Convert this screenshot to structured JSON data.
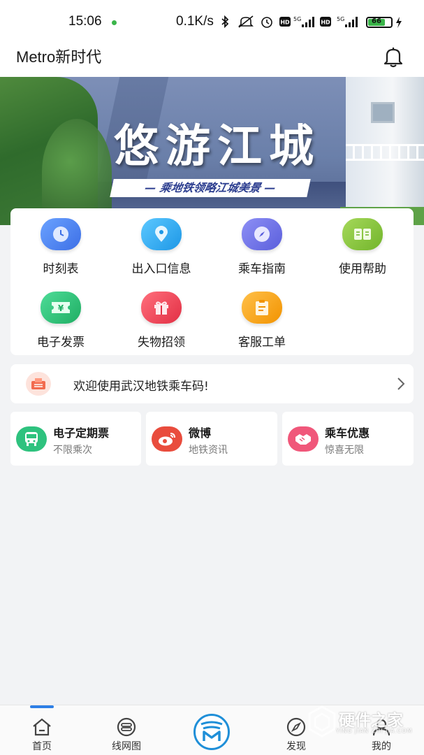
{
  "status_bar": {
    "time": "15:06",
    "network_speed": "0.1K/s",
    "battery": "66",
    "hd_label": "HD",
    "signal_label": "5G"
  },
  "header": {
    "title": "Metro新时代",
    "bell_icon": "bell-icon"
  },
  "banner": {
    "title": "悠游江城",
    "subtitle": "— 乘地铁领略江城美景 —"
  },
  "quick_grid": {
    "items": [
      {
        "label": "时刻表",
        "icon": "clock-icon",
        "color": "#4a84f0"
      },
      {
        "label": "出入口信息",
        "icon": "location-pin-icon",
        "color": "#2fa8ef"
      },
      {
        "label": "乘车指南",
        "icon": "compass-icon",
        "color": "#6f74e8"
      },
      {
        "label": "使用帮助",
        "icon": "book-icon",
        "color": "#8cc63f"
      },
      {
        "label": "电子发票",
        "icon": "ticket-yen-icon",
        "color": "#2fc27d"
      },
      {
        "label": "失物招领",
        "icon": "gift-icon",
        "color": "#ef4b5b"
      },
      {
        "label": "客服工单",
        "icon": "clipboard-icon",
        "color": "#f7a11a"
      }
    ]
  },
  "notice": {
    "text": "欢迎使用武汉地铁乘车码!",
    "icon": "mailbox-icon"
  },
  "features": [
    {
      "title": "电子定期票",
      "subtitle": "不限乘次",
      "icon": "bus-icon",
      "color": "#2ec27e"
    },
    {
      "title": "微博",
      "subtitle": "地铁资讯",
      "icon": "weibo-icon",
      "color": "#e94c3d"
    },
    {
      "title": "乘车优惠",
      "subtitle": "惊喜无限",
      "icon": "handshake-icon",
      "color": "#f0577a"
    }
  ],
  "tabbar": {
    "items": [
      {
        "label": "首页",
        "icon": "home-icon"
      },
      {
        "label": "线网图",
        "icon": "route-map-icon"
      },
      {
        "label": "发现",
        "icon": "compass-icon"
      },
      {
        "label": "我的",
        "icon": "user-icon"
      }
    ],
    "center_icon": "metro-logo-icon",
    "accent": "#2d7fe6"
  },
  "watermark": {
    "text": "硬件之家",
    "sub": "YING JIAN ZHI JIA.COM"
  }
}
